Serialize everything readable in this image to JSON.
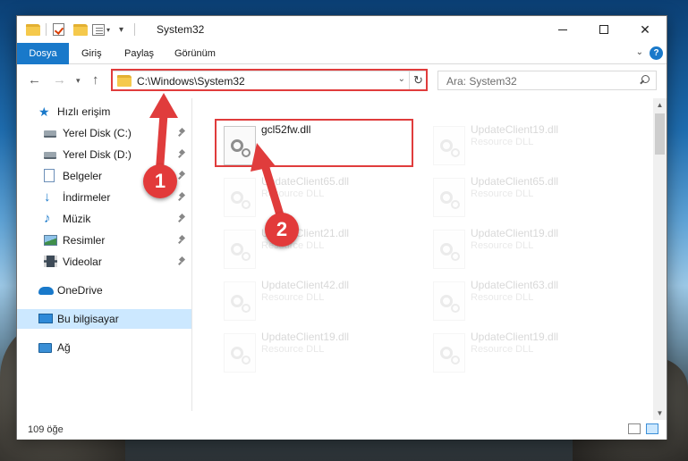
{
  "window": {
    "title": "System32",
    "minimize_label": "Simge durumuna küçült",
    "close_label": "✕"
  },
  "ribbon": {
    "tabs": [
      "Dosya",
      "Giriş",
      "Paylaş",
      "Görünüm"
    ],
    "help_label": "?"
  },
  "address": {
    "path": "C:\\Windows\\System32",
    "search_placeholder": "Ara: System32"
  },
  "sidebar": {
    "items": [
      {
        "label": "Hızlı erişim",
        "icon": "star-icon"
      },
      {
        "label": "Yerel Disk (C:)",
        "icon": "drive-icon",
        "pinned": true
      },
      {
        "label": "Yerel Disk (D:)",
        "icon": "drive-icon",
        "pinned": true
      },
      {
        "label": "Belgeler",
        "icon": "documents-icon",
        "pinned": true
      },
      {
        "label": "İndirmeler",
        "icon": "download-icon",
        "pinned": true
      },
      {
        "label": "Müzik",
        "icon": "music-icon",
        "pinned": true
      },
      {
        "label": "Resimler",
        "icon": "pictures-icon",
        "pinned": true
      },
      {
        "label": "Videolar",
        "icon": "videos-icon",
        "pinned": true
      },
      {
        "label": "OneDrive",
        "icon": "cloud-icon"
      },
      {
        "label": "Bu bilgisayar",
        "icon": "pc-icon",
        "selected": true
      },
      {
        "label": "Ağ",
        "icon": "network-icon"
      }
    ]
  },
  "files": [
    {
      "name": "gcl52fw.dll",
      "type": ""
    },
    {
      "name": "UpdateClient19.dll",
      "type": "Resource DLL"
    },
    {
      "name": "UpdateClient65.dll",
      "type": "Resource DLL"
    },
    {
      "name": "UpdateClient65.dll",
      "type": "Resource DLL"
    },
    {
      "name": "UpdateClient21.dll",
      "type": "Resource DLL"
    },
    {
      "name": "UpdateClient19.dll",
      "type": "Resource DLL"
    },
    {
      "name": "UpdateClient42.dll",
      "type": "Resource DLL"
    },
    {
      "name": "UpdateClient63.dll",
      "type": "Resource DLL"
    },
    {
      "name": "UpdateClient19.dll",
      "type": "Resource DLL"
    },
    {
      "name": "UpdateClient19.dll",
      "type": "Resource DLL"
    }
  ],
  "status": {
    "item_count": "109 öğe"
  },
  "annotations": {
    "step1": "1",
    "step2": "2",
    "color": "#e03c3c"
  }
}
